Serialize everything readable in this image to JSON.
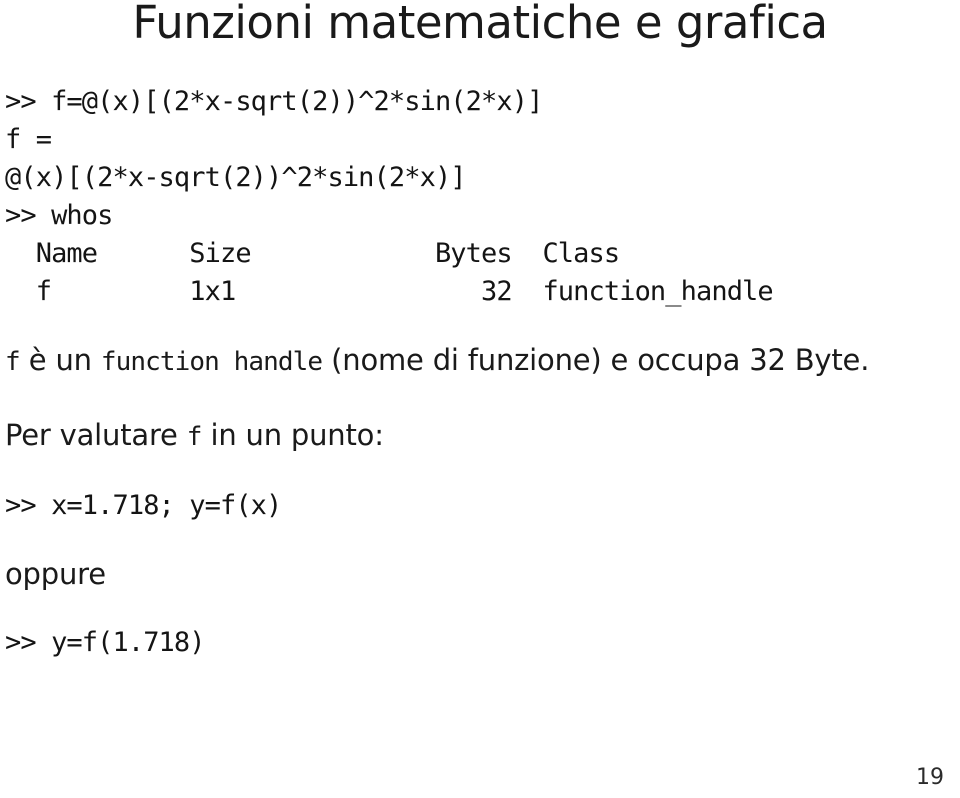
{
  "slide": {
    "title": "Funzioni matematiche e grafica",
    "page_number": "19"
  },
  "console": {
    "line_1": ">> f=@(x)[(2*x-sqrt(2))^2*sin(2*x)]",
    "line_2": "f =",
    "line_3": "@(x)[(2*x-sqrt(2))^2*sin(2*x)]",
    "line_4": ">> whos",
    "whos_header": "  Name      Size            Bytes  Class",
    "whos_row_f": "  f         1x1                32  function_handle",
    "eval_with_var": ">> x=1.718; y=f(x)",
    "eval_direct": ">> y=f(1.718)"
  },
  "whos_table": {
    "columns": [
      "Name",
      "Size",
      "Bytes",
      "Class"
    ],
    "rows": [
      {
        "name": "f",
        "size": "1x1",
        "bytes": "32",
        "class": "function_handle"
      }
    ]
  },
  "prose": {
    "desc_mono_var": "f",
    "desc_part_1": " è un ",
    "desc_mono_term": "function handle",
    "desc_part_2": " (nome di funzione) e occupa 32 Byte.",
    "eval_intro_part_1": "Per valutare ",
    "eval_intro_mono": "f",
    "eval_intro_part_2": " in un punto:",
    "alternative_label": "oppure"
  }
}
